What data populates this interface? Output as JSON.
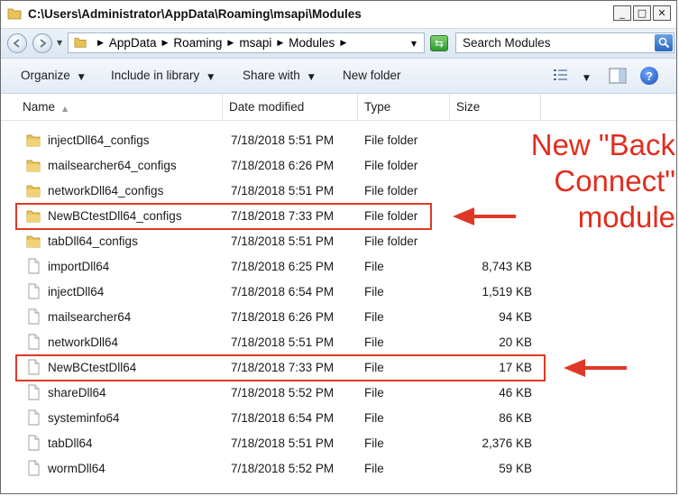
{
  "window": {
    "title": "C:\\Users\\Administrator\\AppData\\Roaming\\msapi\\Modules"
  },
  "address": {
    "crumbs": [
      "AppData",
      "Roaming",
      "msapi",
      "Modules"
    ]
  },
  "search": {
    "placeholder": "Search Modules"
  },
  "toolbar": {
    "organize": "Organize",
    "include_in_library": "Include in library",
    "share_with": "Share with",
    "new_folder": "New folder"
  },
  "columns": {
    "name": "Name",
    "date": "Date modified",
    "type": "Type",
    "size": "Size"
  },
  "files": [
    {
      "name": "injectDll64_configs",
      "date": "7/18/2018 5:51 PM",
      "type": "File folder",
      "size": "",
      "icon": "folder-icon"
    },
    {
      "name": "mailsearcher64_configs",
      "date": "7/18/2018 6:26 PM",
      "type": "File folder",
      "size": "",
      "icon": "folder-icon"
    },
    {
      "name": "networkDll64_configs",
      "date": "7/18/2018 5:51 PM",
      "type": "File folder",
      "size": "",
      "icon": "folder-icon"
    },
    {
      "name": "NewBCtestDll64_configs",
      "date": "7/18/2018 7:33 PM",
      "type": "File folder",
      "size": "",
      "icon": "folder-icon"
    },
    {
      "name": "tabDll64_configs",
      "date": "7/18/2018 5:51 PM",
      "type": "File folder",
      "size": "",
      "icon": "folder-icon"
    },
    {
      "name": "importDll64",
      "date": "7/18/2018 6:25 PM",
      "type": "File",
      "size": "8,743 KB",
      "icon": "file-icon"
    },
    {
      "name": "injectDll64",
      "date": "7/18/2018 6:54 PM",
      "type": "File",
      "size": "1,519 KB",
      "icon": "file-icon"
    },
    {
      "name": "mailsearcher64",
      "date": "7/18/2018 6:26 PM",
      "type": "File",
      "size": "94 KB",
      "icon": "file-icon"
    },
    {
      "name": "networkDll64",
      "date": "7/18/2018 5:51 PM",
      "type": "File",
      "size": "20 KB",
      "icon": "file-icon"
    },
    {
      "name": "NewBCtestDll64",
      "date": "7/18/2018 7:33 PM",
      "type": "File",
      "size": "17 KB",
      "icon": "file-icon"
    },
    {
      "name": "shareDll64",
      "date": "7/18/2018 5:52 PM",
      "type": "File",
      "size": "46 KB",
      "icon": "file-icon"
    },
    {
      "name": "systeminfo64",
      "date": "7/18/2018 6:54 PM",
      "type": "File",
      "size": "86 KB",
      "icon": "file-icon"
    },
    {
      "name": "tabDll64",
      "date": "7/18/2018 5:51 PM",
      "type": "File",
      "size": "2,376 KB",
      "icon": "file-icon"
    },
    {
      "name": "wormDll64",
      "date": "7/18/2018 5:52 PM",
      "type": "File",
      "size": "59 KB",
      "icon": "file-icon"
    }
  ],
  "annotation": {
    "lines": [
      "New \"Back",
      "Connect\"",
      "module"
    ],
    "color": "#e02d1f"
  }
}
